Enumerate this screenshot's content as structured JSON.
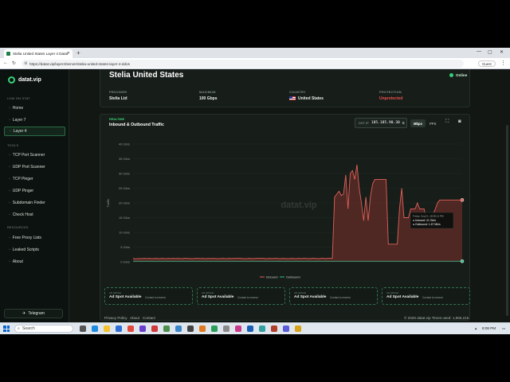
{
  "browser": {
    "tab_title": "Stelia United States Layer 4 Datat",
    "new_tab": "+",
    "url": "https://datat.vip/layer4/server/stelia-united-states-layer-4-ddos",
    "guest_label": "Guest"
  },
  "sidebar": {
    "brand": "datat.vip",
    "sections": [
      {
        "title": "LOW ON STAT",
        "items": [
          {
            "label": "Home",
            "active": false
          },
          {
            "label": "Layer 7",
            "active": false
          },
          {
            "label": "Layer 4",
            "active": true
          }
        ]
      },
      {
        "title": "TOOLS",
        "items": [
          {
            "label": "TCP Port Scanner",
            "active": false
          },
          {
            "label": "UDP Port Scanner",
            "active": false
          },
          {
            "label": "TCP Pinger",
            "active": false
          },
          {
            "label": "UDP Pinger",
            "active": false
          },
          {
            "label": "Subdomain Finder",
            "active": false
          },
          {
            "label": "Check Host",
            "active": false
          }
        ]
      },
      {
        "title": "RESOURCES",
        "items": [
          {
            "label": "Free Proxy Lists",
            "active": false
          },
          {
            "label": "Leaked Scripts",
            "active": false
          },
          {
            "label": "About",
            "active": false
          }
        ]
      }
    ],
    "telegram": "Telegram"
  },
  "server": {
    "title": "Stelia United States",
    "status": "Online",
    "provider_label": "PROVIDER",
    "provider": "Stelia Ltd",
    "maximum_label": "MAXIMUM",
    "maximum": "100 Gbps",
    "country_label": "COUNTRY",
    "country": "United States",
    "protection_label": "PROTECTION",
    "protection": "Unprotected"
  },
  "traffic": {
    "realtime": "REALTIME",
    "title": "Inbound & Outbound Traffic",
    "ip_label": "DST IP",
    "ip": "185.185.90.30",
    "units": [
      "Mbps",
      "PPS"
    ],
    "active_unit": "Mbps",
    "tooltip": {
      "time": "Friday, Aug 21, 08:00:11 PM",
      "inbound": "● Inbound: 21 Gb/s",
      "outbound": "● Outbound: 1.67 Mb/s"
    }
  },
  "chart_data": {
    "type": "area",
    "ylabel": "Traffic",
    "yticks": [
      "0 Gb/s",
      "5 Gb/s",
      "10 Gb/s",
      "15 Gb/s",
      "20 Gb/s",
      "25 Gb/s",
      "30 Gb/s",
      "35 Gb/s",
      "40 Gb/s"
    ],
    "ylim": [
      0,
      40
    ],
    "legend_position": "bottom",
    "colors": {
      "inbound": "#e0605a",
      "outbound": "#2fbf8f",
      "fill": "#5a2a26"
    },
    "series": [
      {
        "name": "Inbound",
        "values": [
          1.2,
          1.0,
          1.1,
          1.1,
          1.1,
          1.2,
          1.1,
          1.2,
          1.1,
          1.1,
          1.2,
          1.1,
          1.1,
          1.2,
          1.1,
          1.1,
          1.2,
          1.1,
          1.2,
          1.1,
          1.2,
          1.1,
          1.1,
          1.2,
          1.2,
          1.1,
          1.1,
          1.1,
          1.2,
          1.2,
          1.1,
          1.2,
          1.1,
          1.1,
          1.2,
          1.1,
          1.2,
          1.1,
          1.1,
          1.1,
          1.2,
          1.1,
          1.1,
          1.2,
          1.1,
          1.2,
          1.2,
          1.2,
          1.2,
          1.1,
          1.1,
          1.1,
          1.2,
          1.1,
          1.1,
          1.2,
          1.2,
          1.2,
          1.2,
          1.1,
          1.1,
          1.2,
          1.1,
          1.2,
          1.2,
          1.1,
          1.1,
          1.2,
          1.1,
          1.1,
          1.1,
          1.2,
          1.1,
          1.1,
          1.2,
          1.1,
          1.2,
          1.2,
          1.1,
          1.1,
          1.2,
          1.2,
          1.1,
          1.1,
          1.2,
          1.2,
          1.1,
          1.2,
          1.2,
          1.2,
          22,
          23,
          24,
          22.5,
          23,
          29.5,
          18,
          30,
          31,
          28,
          33,
          25,
          20,
          14,
          22,
          14,
          22,
          26.5,
          28,
          28,
          28,
          28,
          28,
          28,
          6,
          6,
          6,
          6,
          6,
          18,
          25,
          15,
          15,
          15,
          18,
          18,
          18,
          20,
          18,
          18,
          18,
          14,
          14,
          15,
          16,
          18,
          20,
          21,
          21,
          21,
          21,
          21,
          21,
          21,
          21,
          21,
          21,
          21
        ]
      },
      {
        "name": "Outbound",
        "values": [
          0.2,
          0.2,
          0.2,
          0.2,
          0.2,
          0.2,
          0.2,
          0.2,
          0.2,
          0.2,
          0.2,
          0.2,
          0.2,
          0.2,
          0.2,
          0.2,
          0.2,
          0.2,
          0.2,
          0.2,
          0.2,
          0.2,
          0.2,
          0.2,
          0.2,
          0.2,
          0.2,
          0.2,
          0.2,
          0.2,
          0.2,
          0.2,
          0.2,
          0.2,
          0.2,
          0.2,
          0.2,
          0.2,
          0.2,
          0.2,
          0.2,
          0.2,
          0.2,
          0.2,
          0.2,
          0.2,
          0.2,
          0.2,
          0.2,
          0.2,
          0.2,
          0.2,
          0.2,
          0.2,
          0.2,
          0.2,
          0.2,
          0.2,
          0.2,
          0.2,
          0.2,
          0.2,
          0.2,
          0.2,
          0.2,
          0.2,
          0.2,
          0.2,
          0.2,
          0.2,
          0.2,
          0.2,
          0.2,
          0.2,
          0.2,
          0.2,
          0.2,
          0.2,
          0.2,
          0.2,
          0.2,
          0.2,
          0.2,
          0.2,
          0.2,
          0.2,
          0.2,
          0.2,
          0.2,
          0.2,
          0.2,
          0.2,
          0.2,
          0.2,
          0.2,
          0.2,
          0.2,
          0.2,
          0.2,
          0.2,
          0.2,
          0.2,
          0.2,
          0.2,
          0.2,
          0.2,
          0.2,
          0.2,
          0.2,
          0.2,
          0.2,
          0.2,
          0.2,
          0.2,
          0.2,
          0.2,
          0.2,
          0.2,
          0.2,
          0.2,
          0.2,
          0.2,
          0.2,
          0.2,
          0.2,
          0.2,
          0.2,
          0.2,
          0.2,
          0.2,
          0.2,
          0.2,
          0.2,
          0.2,
          0.2,
          0.2,
          0.2,
          0.2,
          0.2,
          0.2,
          0.2,
          0.2,
          0.2,
          0.2,
          0.2,
          0.2,
          0.2,
          0.2
        ]
      }
    ],
    "watermark": "datat.vip"
  },
  "ads": [
    {
      "small": "AD SPACE",
      "title": "Ad Spot Available",
      "sub": "Contact to reserve"
    },
    {
      "small": "AD SPACE",
      "title": "Ad Spot Available",
      "sub": "Contact to reserve"
    },
    {
      "small": "AD SPACE",
      "title": "Ad Spot Available",
      "sub": "Contact to reserve"
    },
    {
      "small": "AD SPACE",
      "title": "Ad Spot Available",
      "sub": "Contact to reserve"
    }
  ],
  "footer": {
    "links": [
      "Privacy Policy",
      "About",
      "Contact"
    ],
    "right": "© 2026 datat.vip   Times used: 1,856,215"
  },
  "taskbar": {
    "search": "Search",
    "clock": "8:08 PM"
  }
}
